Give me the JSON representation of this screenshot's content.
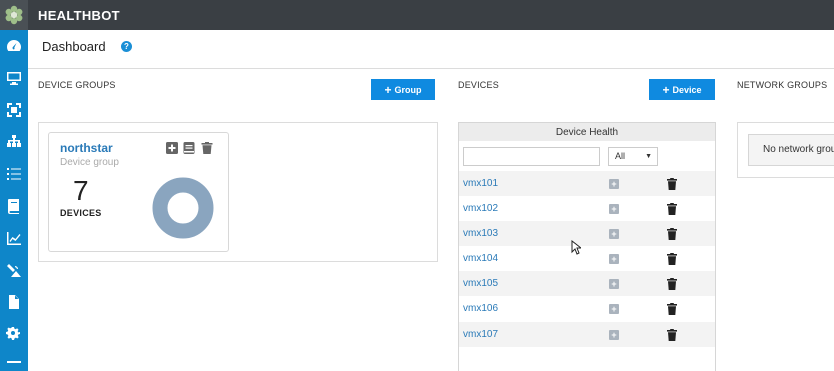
{
  "app": {
    "title": "HEALTHBOT"
  },
  "header": {
    "title": "Dashboard",
    "help": "?"
  },
  "sidebar": {
    "items": [
      {
        "icon": "dashboard-icon"
      },
      {
        "icon": "monitor-icon"
      },
      {
        "icon": "resize-icon"
      },
      {
        "icon": "network-tree-icon"
      },
      {
        "icon": "list-icon"
      },
      {
        "icon": "book-icon"
      },
      {
        "icon": "chart-icon"
      },
      {
        "icon": "satellite-icon"
      },
      {
        "icon": "document-icon"
      },
      {
        "icon": "settings-icon"
      }
    ]
  },
  "device_groups": {
    "label": "DEVICE GROUPS",
    "add_button": "Group",
    "card": {
      "name": "northstar",
      "subtitle": "Device group",
      "count": "7",
      "count_label": "DEVICES"
    }
  },
  "devices": {
    "label": "DEVICES",
    "add_button": "Device",
    "table_title": "Device Health",
    "filter_placeholder": "",
    "filter_select": "All",
    "rows": [
      {
        "name": "vmx101"
      },
      {
        "name": "vmx102"
      },
      {
        "name": "vmx103"
      },
      {
        "name": "vmx104"
      },
      {
        "name": "vmx105"
      },
      {
        "name": "vmx106"
      },
      {
        "name": "vmx107"
      }
    ]
  },
  "network_groups": {
    "label": "NETWORK GROUPS",
    "empty_message": "No network grou"
  },
  "colors": {
    "accent": "#0f8ae0",
    "sidebar": "#0e86c9",
    "topbar": "#3a3f44",
    "donut": "#8aa5bf"
  }
}
